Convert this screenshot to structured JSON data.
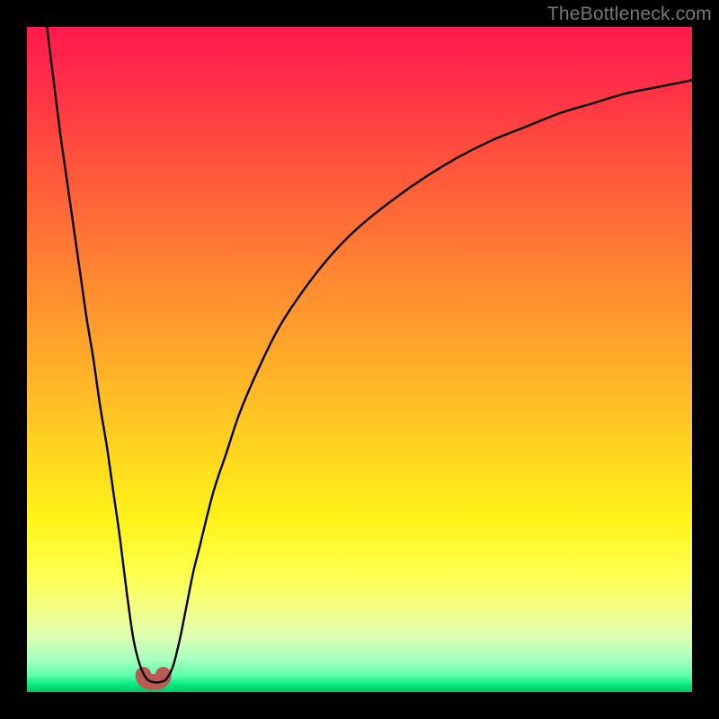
{
  "watermark": "TheBottleneck.com",
  "chart_data": {
    "type": "line",
    "title": "",
    "xlabel": "",
    "ylabel": "",
    "xlim": [
      0,
      100
    ],
    "ylim": [
      0,
      100
    ],
    "grid": false,
    "legend": false,
    "gradient_stops": [
      {
        "pos": 0,
        "color": "#ff1a4d"
      },
      {
        "pos": 7,
        "color": "#ff2a4a"
      },
      {
        "pos": 15,
        "color": "#ff4340"
      },
      {
        "pos": 28,
        "color": "#ff6a37"
      },
      {
        "pos": 40,
        "color": "#ff8f30"
      },
      {
        "pos": 52,
        "color": "#ffb128"
      },
      {
        "pos": 64,
        "color": "#ffd61f"
      },
      {
        "pos": 74,
        "color": "#fff31a"
      },
      {
        "pos": 82,
        "color": "#fdff4a"
      },
      {
        "pos": 88,
        "color": "#f2ff8c"
      },
      {
        "pos": 92,
        "color": "#d9ffb3"
      },
      {
        "pos": 95,
        "color": "#a8ffbf"
      },
      {
        "pos": 97.5,
        "color": "#5effad"
      },
      {
        "pos": 99,
        "color": "#00e87a"
      },
      {
        "pos": 100,
        "color": "#00c864"
      }
    ],
    "series": [
      {
        "name": "bottleneck-curve",
        "color": "#000000",
        "x": [
          3,
          4,
          5,
          6,
          7,
          8,
          9,
          10,
          11,
          12,
          13,
          14,
          15,
          16,
          17,
          18,
          19,
          20,
          21,
          22,
          23,
          24,
          25,
          26,
          28,
          30,
          32,
          35,
          38,
          42,
          46,
          50,
          55,
          60,
          65,
          70,
          75,
          80,
          85,
          90,
          95,
          100
        ],
        "y": [
          100,
          92,
          84,
          77,
          70,
          63,
          56,
          50,
          43,
          37,
          30,
          23,
          15,
          8,
          4,
          2,
          1.5,
          1.5,
          2,
          4,
          8,
          13,
          18,
          22,
          30,
          36,
          42,
          49,
          55,
          61,
          66,
          70,
          74,
          77.5,
          80.5,
          83,
          85,
          87,
          88.5,
          90,
          91,
          92
        ]
      }
    ],
    "dip_marker": {
      "color": "#bb5a54",
      "x_range": [
        17.5,
        20.5
      ],
      "y": 1.5,
      "thickness_pct": 2.4
    }
  }
}
